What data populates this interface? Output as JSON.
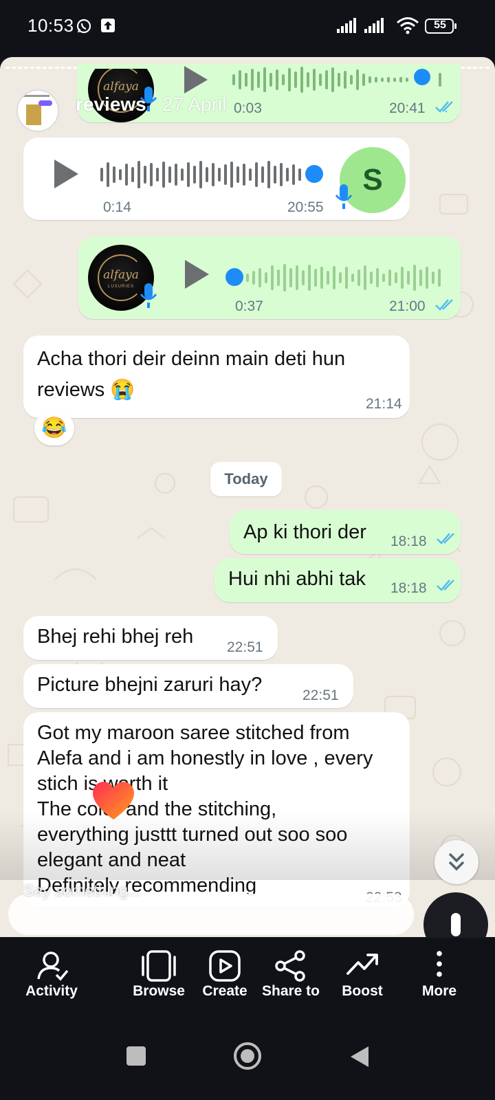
{
  "status_bar": {
    "time": "10:53",
    "battery": "55",
    "icons": [
      "whatsapp-icon",
      "upload-icon",
      "signal-icon",
      "signal-icon",
      "wifi-icon",
      "battery-icon"
    ]
  },
  "story": {
    "title": "reviews",
    "date": "27 April",
    "comment_placeholder": "Say something..."
  },
  "chat": {
    "messages": [
      {
        "type": "voice",
        "direction": "out",
        "duration": "0:03",
        "time": "20:41",
        "progress": 1.0
      },
      {
        "type": "voice",
        "direction": "in",
        "duration": "0:14",
        "time": "20:55",
        "avatar_letter": "S",
        "progress": 1.0
      },
      {
        "type": "voice",
        "direction": "out",
        "duration": "0:37",
        "time": "21:00",
        "progress": 0.0
      },
      {
        "type": "text",
        "direction": "in",
        "text": "Acha thori deir deinn main deti hun\nreviews 😭",
        "time": "21:14",
        "reaction": "😂"
      },
      {
        "type": "date_chip",
        "text": "Today"
      },
      {
        "type": "text",
        "direction": "out",
        "text": "Ap ki thori der",
        "time": "18:18"
      },
      {
        "type": "text",
        "direction": "out",
        "text": "Hui nhi abhi tak",
        "time": "18:18"
      },
      {
        "type": "text",
        "direction": "in",
        "text": "Bhej rehi bhej reh",
        "time": "22:51"
      },
      {
        "type": "text",
        "direction": "in",
        "text": "Picture bhejni zaruri hay?",
        "time": "22:51"
      },
      {
        "type": "text",
        "direction": "in",
        "text": "Got my maroon saree stitched from\nAlefa and i am honestly in love , every\nstich is worth it\nThe color and the stitching,\neverything justtt turned out soo soo\nelegant and neat\nDefinitely recommending",
        "time": "22:53"
      }
    ]
  },
  "actions": [
    {
      "label": "Activity",
      "icon": "activity-icon"
    },
    {
      "label": "Browse",
      "icon": "browse-icon"
    },
    {
      "label": "Create",
      "icon": "create-icon"
    },
    {
      "label": "Share to",
      "icon": "share-icon"
    },
    {
      "label": "Boost",
      "icon": "boost-icon"
    },
    {
      "label": "More",
      "icon": "more-icon"
    }
  ],
  "colors": {
    "chat_bg": "#efeae2",
    "outgoing": "#d9fdd3",
    "incoming": "#ffffff",
    "read_ticks": "#53bdeb",
    "voice_dot": "#1d8cf8",
    "contact_avatar": "#9ee78e"
  }
}
